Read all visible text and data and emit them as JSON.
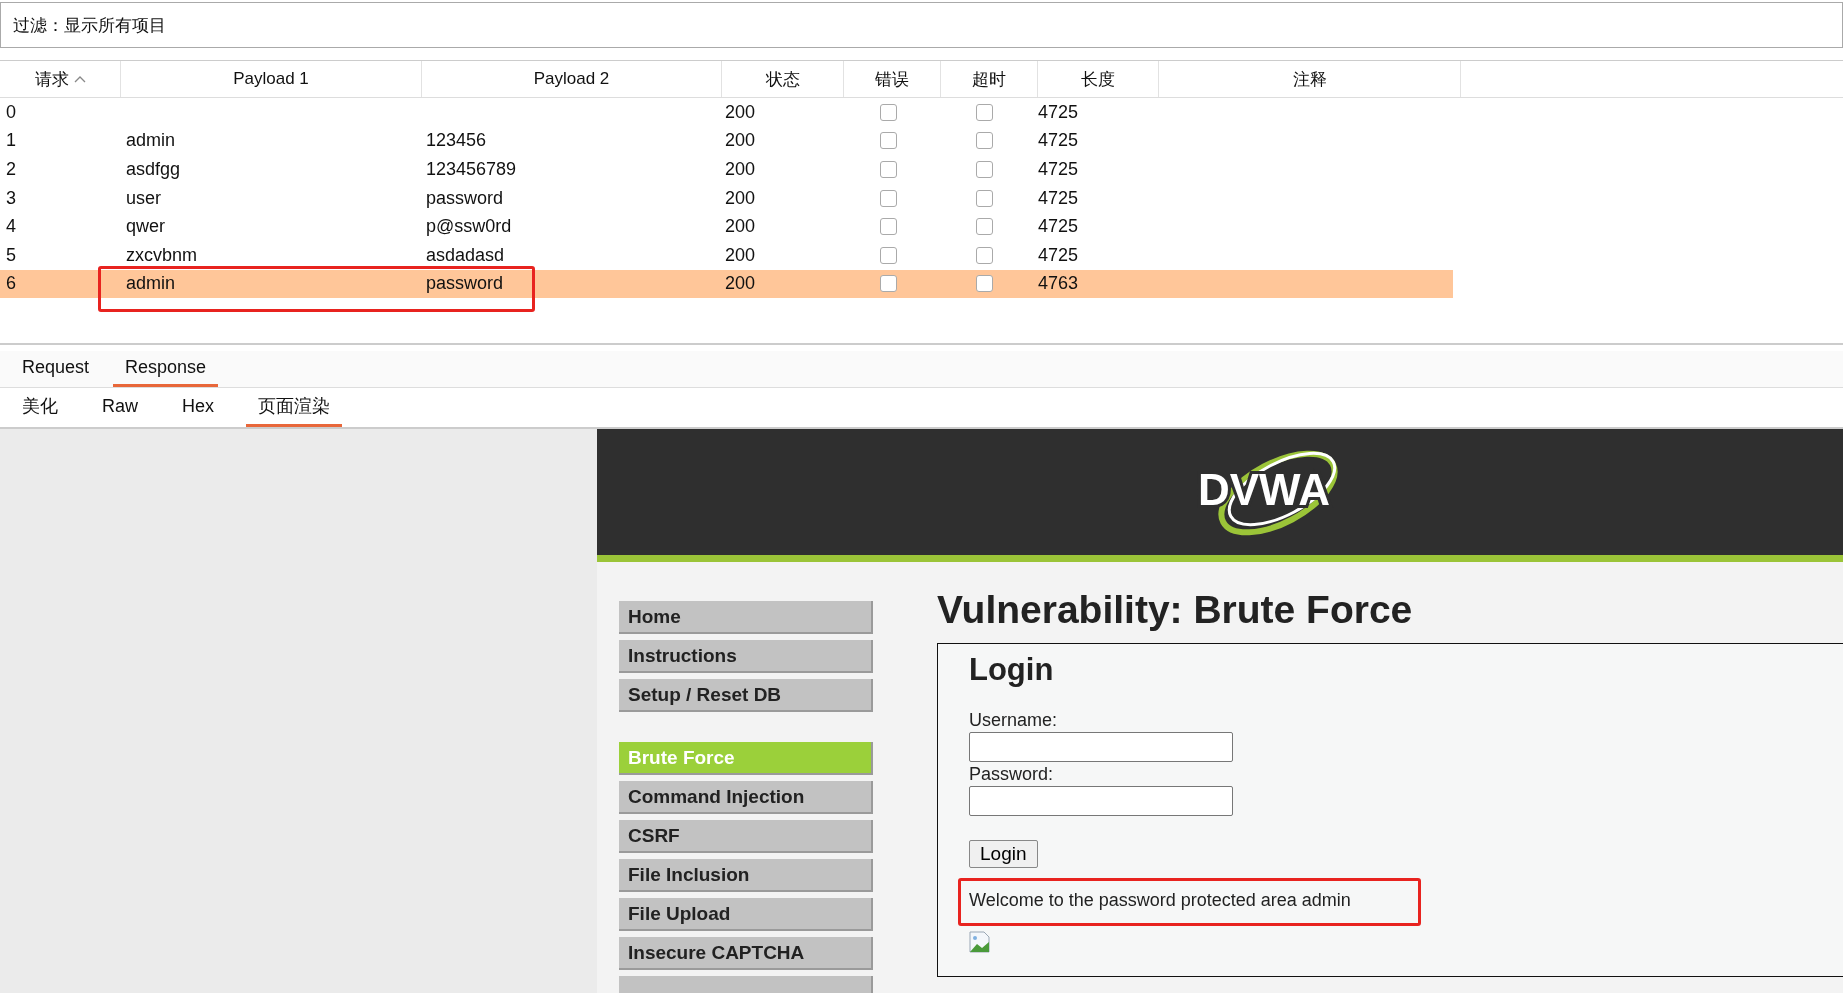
{
  "filter": {
    "label": "过滤：显示所有项目"
  },
  "table": {
    "columns": [
      {
        "label": "请求",
        "sorted": true
      },
      {
        "label": "Payload 1",
        "sorted": false
      },
      {
        "label": "Payload 2",
        "sorted": false
      },
      {
        "label": "状态",
        "sorted": false
      },
      {
        "label": "错误",
        "sorted": false
      },
      {
        "label": "超时",
        "sorted": false
      },
      {
        "label": "长度",
        "sorted": false
      },
      {
        "label": "注释",
        "sorted": false
      }
    ],
    "rows": [
      {
        "request": "0",
        "payload_1": "",
        "payload_2": "",
        "status": "200",
        "error": false,
        "timeout": false,
        "length": "4725",
        "selected": false
      },
      {
        "request": "1",
        "payload_1": "admin",
        "payload_2": "123456",
        "status": "200",
        "error": false,
        "timeout": false,
        "length": "4725",
        "selected": false
      },
      {
        "request": "2",
        "payload_1": "asdfgg",
        "payload_2": "123456789",
        "status": "200",
        "error": false,
        "timeout": false,
        "length": "4725",
        "selected": false
      },
      {
        "request": "3",
        "payload_1": "user",
        "payload_2": "password",
        "status": "200",
        "error": false,
        "timeout": false,
        "length": "4725",
        "selected": false
      },
      {
        "request": "4",
        "payload_1": "qwer",
        "payload_2": "p@ssw0rd",
        "status": "200",
        "error": false,
        "timeout": false,
        "length": "4725",
        "selected": false
      },
      {
        "request": "5",
        "payload_1": "zxcvbnm",
        "payload_2": "asdadasd",
        "status": "200",
        "error": false,
        "timeout": false,
        "length": "4725",
        "selected": false
      },
      {
        "request": "6",
        "payload_1": "admin",
        "payload_2": "password",
        "status": "200",
        "error": false,
        "timeout": false,
        "length": "4763",
        "selected": true
      }
    ]
  },
  "message_tabs": [
    {
      "label": "Request",
      "selected": false
    },
    {
      "label": "Response",
      "selected": true
    }
  ],
  "view_tabs": [
    {
      "label": "美化",
      "selected": false
    },
    {
      "label": "Raw",
      "selected": false
    },
    {
      "label": "Hex",
      "selected": false
    },
    {
      "label": "页面渲染",
      "selected": true
    }
  ],
  "rendered_page": {
    "logo": "DVWA",
    "menu": [
      [
        {
          "label": "Home",
          "selected": false
        },
        {
          "label": "Instructions",
          "selected": false
        },
        {
          "label": "Setup / Reset DB",
          "selected": false
        }
      ],
      [
        {
          "label": "Brute Force",
          "selected": true
        },
        {
          "label": "Command Injection",
          "selected": false
        },
        {
          "label": "CSRF",
          "selected": false
        },
        {
          "label": "File Inclusion",
          "selected": false
        },
        {
          "label": "File Upload",
          "selected": false
        },
        {
          "label": "Insecure CAPTCHA",
          "selected": false
        }
      ]
    ],
    "heading": "Vulnerability: Brute Force",
    "login": {
      "title": "Login",
      "username_label": "Username:",
      "password_label": "Password:",
      "button": "Login",
      "message": "Welcome to the password protected area admin"
    }
  }
}
